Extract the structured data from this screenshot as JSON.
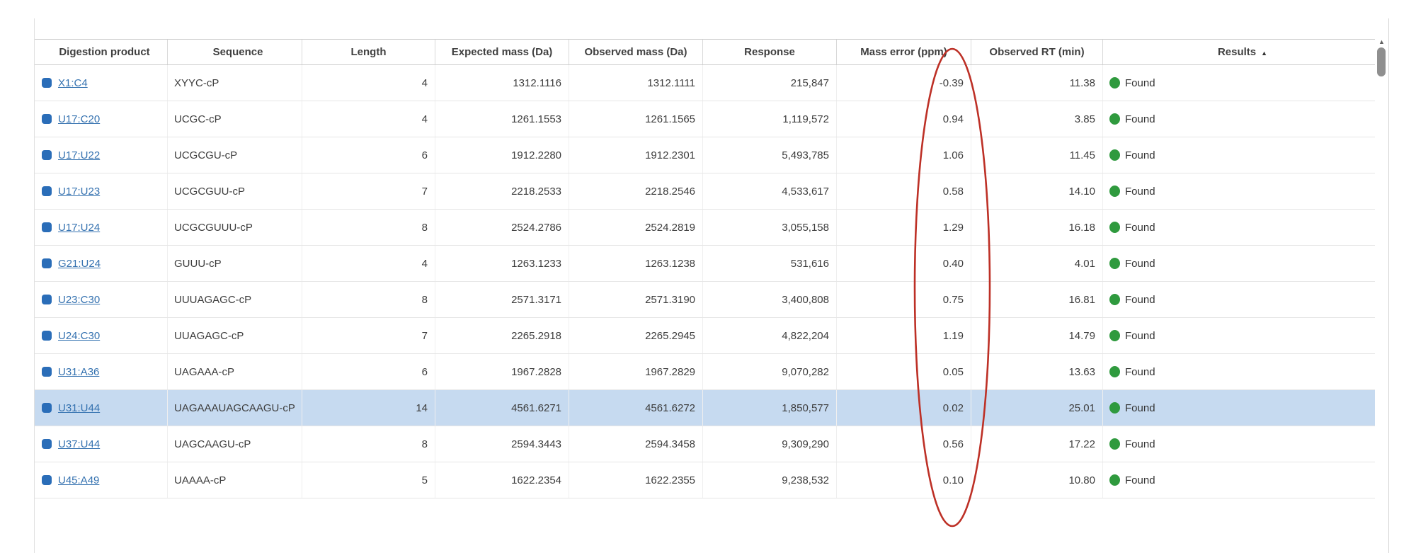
{
  "table": {
    "columns": [
      {
        "label": "Digestion product"
      },
      {
        "label": "Sequence"
      },
      {
        "label": "Length"
      },
      {
        "label": "Expected mass (Da)"
      },
      {
        "label": "Observed mass (Da)"
      },
      {
        "label": "Response"
      },
      {
        "label": "Mass error (ppm)"
      },
      {
        "label": "Observed RT (min)"
      },
      {
        "label": "Results",
        "sort_indicator": "▲"
      }
    ],
    "rows": [
      {
        "product": "X1:C4",
        "sequence": "XYYC-cP",
        "length": "4",
        "expected_mass": "1312.1116",
        "observed_mass": "1312.1111",
        "response": "215,847",
        "mass_error": "-0.39",
        "observed_rt": "11.38",
        "result": "Found",
        "selected": false
      },
      {
        "product": "U17:C20",
        "sequence": "UCGC-cP",
        "length": "4",
        "expected_mass": "1261.1553",
        "observed_mass": "1261.1565",
        "response": "1,119,572",
        "mass_error": "0.94",
        "observed_rt": "3.85",
        "result": "Found",
        "selected": false
      },
      {
        "product": "U17:U22",
        "sequence": "UCGCGU-cP",
        "length": "6",
        "expected_mass": "1912.2280",
        "observed_mass": "1912.2301",
        "response": "5,493,785",
        "mass_error": "1.06",
        "observed_rt": "11.45",
        "result": "Found",
        "selected": false
      },
      {
        "product": "U17:U23",
        "sequence": "UCGCGUU-cP",
        "length": "7",
        "expected_mass": "2218.2533",
        "observed_mass": "2218.2546",
        "response": "4,533,617",
        "mass_error": "0.58",
        "observed_rt": "14.10",
        "result": "Found",
        "selected": false
      },
      {
        "product": "U17:U24",
        "sequence": "UCGCGUUU-cP",
        "length": "8",
        "expected_mass": "2524.2786",
        "observed_mass": "2524.2819",
        "response": "3,055,158",
        "mass_error": "1.29",
        "observed_rt": "16.18",
        "result": "Found",
        "selected": false
      },
      {
        "product": "G21:U24",
        "sequence": "GUUU-cP",
        "length": "4",
        "expected_mass": "1263.1233",
        "observed_mass": "1263.1238",
        "response": "531,616",
        "mass_error": "0.40",
        "observed_rt": "4.01",
        "result": "Found",
        "selected": false
      },
      {
        "product": "U23:C30",
        "sequence": "UUUAGAGC-cP",
        "length": "8",
        "expected_mass": "2571.3171",
        "observed_mass": "2571.3190",
        "response": "3,400,808",
        "mass_error": "0.75",
        "observed_rt": "16.81",
        "result": "Found",
        "selected": false
      },
      {
        "product": "U24:C30",
        "sequence": "UUAGAGC-cP",
        "length": "7",
        "expected_mass": "2265.2918",
        "observed_mass": "2265.2945",
        "response": "4,822,204",
        "mass_error": "1.19",
        "observed_rt": "14.79",
        "result": "Found",
        "selected": false
      },
      {
        "product": "U31:A36",
        "sequence": "UAGAAA-cP",
        "length": "6",
        "expected_mass": "1967.2828",
        "observed_mass": "1967.2829",
        "response": "9,070,282",
        "mass_error": "0.05",
        "observed_rt": "13.63",
        "result": "Found",
        "selected": false
      },
      {
        "product": "U31:U44",
        "sequence": "UAGAAAUAGCAAGU-cP",
        "length": "14",
        "expected_mass": "4561.6271",
        "observed_mass": "4561.6272",
        "response": "1,850,577",
        "mass_error": "0.02",
        "observed_rt": "25.01",
        "result": "Found",
        "selected": true
      },
      {
        "product": "U37:U44",
        "sequence": "UAGCAAGU-cP",
        "length": "8",
        "expected_mass": "2594.3443",
        "observed_mass": "2594.3458",
        "response": "9,309,290",
        "mass_error": "0.56",
        "observed_rt": "17.22",
        "result": "Found",
        "selected": false
      },
      {
        "product": "U45:A49",
        "sequence": "UAAAA-cP",
        "length": "5",
        "expected_mass": "1622.2354",
        "observed_mass": "1622.2355",
        "response": "9,238,532",
        "mass_error": "0.10",
        "observed_rt": "10.80",
        "result": "Found",
        "selected": false
      }
    ]
  },
  "icons": {
    "scroll_up": "▲"
  },
  "colors": {
    "link_blue": "#3572b0",
    "product_square_blue": "#2a6db8",
    "found_green": "#2f9a3e",
    "selected_row_blue": "#c6daf0",
    "annotation_red": "#bd3026"
  },
  "annotation": {
    "shape": "ellipse",
    "circled_column": "Mass error (ppm)",
    "color": "#bd3026"
  }
}
